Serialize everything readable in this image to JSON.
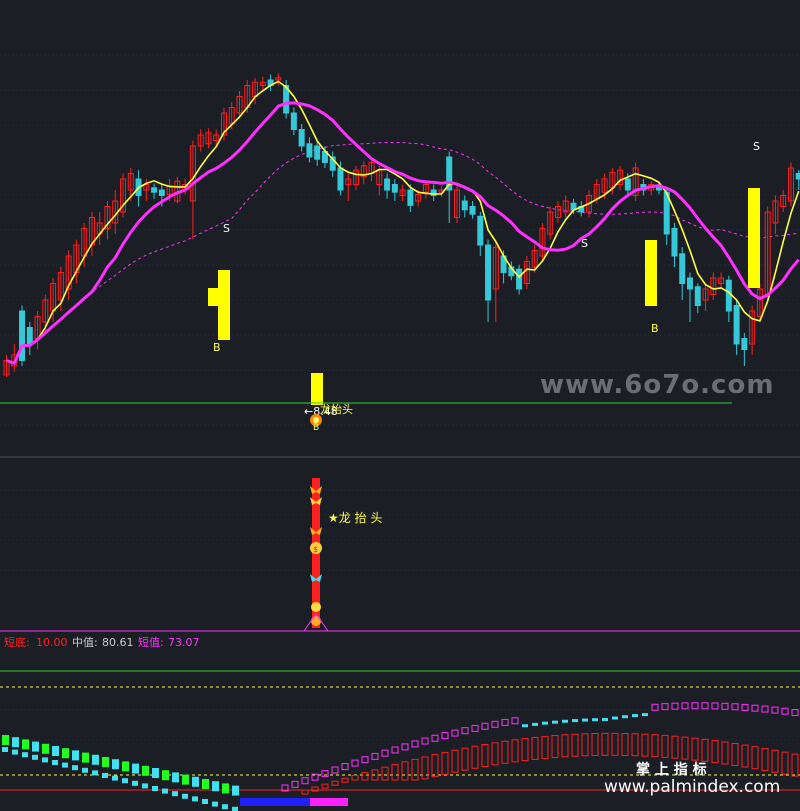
{
  "colors": {
    "background": "#1b1e25",
    "grid": "#3a3f4a",
    "up": "#ff2020",
    "down": "#35c8d8",
    "ma_short": "#ffff40",
    "ma_long": "#ff30ff",
    "ma_dotted": "#ff30ff",
    "signal_bar": "#ffff00",
    "support_line": "#30d030",
    "panel_red": "#ff2020",
    "panel_mid": "#cccccc",
    "panel_magenta": "#ff30ff",
    "cyan": "#40e0f0",
    "green": "#20ff20"
  },
  "main_panel": {
    "signals": [
      {
        "label": "S"
      },
      {
        "label": "B"
      },
      {
        "label": "S"
      },
      {
        "label": "B"
      },
      {
        "label": "S"
      }
    ],
    "low_price_label": "←8.48",
    "dragon_label": "龙抬头",
    "bottom_marker": "B"
  },
  "middle_panel": {
    "annotation": "★龙 抬 头"
  },
  "lower_panel": {
    "legend": [
      {
        "name": "短底:",
        "value": "10.00",
        "color": "#ff2020"
      },
      {
        "name": "中值:",
        "value": "80.61",
        "color": "#cccccc"
      },
      {
        "name": "短值:",
        "value": "73.07",
        "color": "#ff30ff"
      }
    ]
  },
  "watermarks": {
    "top": "www.6o7o.com",
    "cn": "掌  上  指  标",
    "bottom": "www.palmindex.com"
  },
  "chart_data": {
    "type": "candlestick",
    "title": "",
    "low_marker_value": 8.48,
    "candles_note": "qualitative trace",
    "candles": [
      [
        0,
        132,
        145,
        130,
        150,
        0
      ],
      [
        1,
        150,
        140,
        135,
        160,
        0
      ],
      [
        2,
        145,
        190,
        140,
        195,
        1
      ],
      [
        3,
        175,
        160,
        150,
        180,
        1
      ],
      [
        4,
        165,
        185,
        155,
        190,
        0
      ],
      [
        5,
        180,
        200,
        170,
        205,
        0
      ],
      [
        6,
        190,
        215,
        180,
        220,
        0
      ],
      [
        7,
        200,
        225,
        190,
        230,
        0
      ],
      [
        8,
        210,
        240,
        200,
        245,
        0
      ],
      [
        9,
        225,
        250,
        215,
        255,
        0
      ],
      [
        10,
        240,
        265,
        230,
        270,
        0
      ],
      [
        11,
        250,
        275,
        240,
        280,
        0
      ],
      [
        12,
        260,
        270,
        250,
        280,
        0
      ],
      [
        13,
        265,
        285,
        255,
        290,
        0
      ],
      [
        14,
        270,
        290,
        260,
        300,
        0
      ],
      [
        15,
        280,
        310,
        275,
        315,
        0
      ],
      [
        16,
        300,
        315,
        290,
        320,
        0
      ],
      [
        17,
        295,
        310,
        285,
        318,
        1
      ],
      [
        18,
        300,
        305,
        290,
        310,
        0
      ],
      [
        19,
        298,
        302,
        292,
        306,
        1
      ],
      [
        20,
        300,
        295,
        285,
        305,
        1
      ],
      [
        21,
        296,
        304,
        290,
        310,
        0
      ],
      [
        22,
        290,
        308,
        288,
        312,
        0
      ],
      [
        23,
        300,
        305,
        296,
        310,
        0
      ],
      [
        24,
        290,
        340,
        255,
        345,
        0
      ],
      [
        25,
        340,
        350,
        335,
        355,
        0
      ],
      [
        26,
        342,
        352,
        338,
        356,
        0
      ],
      [
        27,
        345,
        350,
        340,
        355,
        0
      ],
      [
        28,
        350,
        370,
        345,
        375,
        0
      ],
      [
        29,
        360,
        375,
        355,
        380,
        0
      ],
      [
        30,
        370,
        385,
        365,
        390,
        0
      ],
      [
        31,
        375,
        395,
        370,
        400,
        0
      ],
      [
        32,
        385,
        398,
        378,
        402,
        0
      ],
      [
        33,
        395,
        398,
        390,
        403,
        0
      ],
      [
        34,
        395,
        400,
        390,
        405,
        1
      ],
      [
        35,
        400,
        402,
        395,
        406,
        0
      ],
      [
        36,
        395,
        370,
        365,
        400,
        1
      ],
      [
        37,
        370,
        355,
        350,
        375,
        1
      ],
      [
        38,
        355,
        340,
        335,
        360,
        1
      ],
      [
        39,
        342,
        330,
        325,
        348,
        1
      ],
      [
        40,
        340,
        328,
        322,
        345,
        1
      ],
      [
        41,
        335,
        325,
        320,
        340,
        1
      ],
      [
        42,
        330,
        318,
        312,
        335,
        1
      ],
      [
        43,
        320,
        300,
        295,
        326,
        1
      ],
      [
        44,
        305,
        310,
        290,
        315,
        0
      ],
      [
        45,
        305,
        318,
        300,
        322,
        0
      ],
      [
        46,
        312,
        322,
        305,
        326,
        0
      ],
      [
        47,
        315,
        325,
        308,
        330,
        0
      ],
      [
        48,
        305,
        318,
        295,
        322,
        0
      ],
      [
        49,
        300,
        310,
        292,
        315,
        1
      ],
      [
        50,
        305,
        298,
        290,
        310,
        1
      ],
      [
        51,
        295,
        300,
        290,
        305,
        0
      ],
      [
        52,
        300,
        286,
        280,
        305,
        1
      ],
      [
        53,
        290,
        296,
        285,
        300,
        0
      ],
      [
        54,
        298,
        305,
        292,
        308,
        0
      ],
      [
        55,
        300,
        295,
        290,
        305,
        1
      ],
      [
        56,
        298,
        300,
        294,
        304,
        0
      ],
      [
        57,
        300,
        330,
        270,
        335,
        1
      ],
      [
        58,
        275,
        300,
        270,
        305,
        0
      ],
      [
        59,
        282,
        290,
        275,
        295,
        1
      ],
      [
        60,
        285,
        278,
        274,
        290,
        1
      ],
      [
        61,
        276,
        250,
        240,
        280,
        1
      ],
      [
        62,
        250,
        200,
        180,
        255,
        1
      ],
      [
        63,
        210,
        248,
        180,
        255,
        0
      ],
      [
        64,
        240,
        225,
        215,
        245,
        1
      ],
      [
        65,
        230,
        222,
        218,
        235,
        1
      ],
      [
        66,
        228,
        210,
        205,
        232,
        1
      ],
      [
        67,
        215,
        235,
        210,
        240,
        0
      ],
      [
        68,
        230,
        245,
        225,
        250,
        0
      ],
      [
        69,
        240,
        265,
        235,
        270,
        0
      ],
      [
        70,
        260,
        280,
        255,
        285,
        0
      ],
      [
        71,
        275,
        285,
        270,
        290,
        0
      ],
      [
        72,
        280,
        290,
        275,
        295,
        0
      ],
      [
        73,
        282,
        288,
        278,
        292,
        1
      ],
      [
        74,
        285,
        280,
        276,
        290,
        1
      ],
      [
        75,
        280,
        295,
        275,
        300,
        0
      ],
      [
        76,
        292,
        305,
        288,
        310,
        0
      ],
      [
        77,
        298,
        310,
        292,
        315,
        0
      ],
      [
        78,
        302,
        316,
        296,
        320,
        0
      ],
      [
        79,
        305,
        318,
        300,
        322,
        0
      ],
      [
        80,
        300,
        310,
        295,
        315,
        1
      ],
      [
        81,
        295,
        320,
        290,
        325,
        0
      ],
      [
        82,
        305,
        300,
        295,
        310,
        1
      ],
      [
        83,
        300,
        305,
        295,
        308,
        0
      ],
      [
        84,
        302,
        300,
        296,
        306,
        1
      ],
      [
        85,
        298,
        260,
        250,
        302,
        1
      ],
      [
        86,
        265,
        240,
        230,
        270,
        1
      ],
      [
        87,
        242,
        215,
        200,
        248,
        1
      ],
      [
        88,
        220,
        210,
        180,
        225,
        1
      ],
      [
        89,
        212,
        195,
        188,
        215,
        1
      ],
      [
        90,
        200,
        210,
        190,
        215,
        0
      ],
      [
        91,
        205,
        220,
        200,
        225,
        0
      ],
      [
        92,
        215,
        220,
        210,
        225,
        0
      ],
      [
        93,
        218,
        190,
        180,
        222,
        1
      ],
      [
        94,
        195,
        160,
        150,
        200,
        1
      ],
      [
        95,
        165,
        155,
        140,
        170,
        1
      ],
      [
        96,
        160,
        190,
        150,
        195,
        0
      ],
      [
        97,
        185,
        210,
        180,
        215,
        0
      ],
      [
        98,
        205,
        280,
        200,
        285,
        0
      ],
      [
        99,
        270,
        290,
        260,
        295,
        0
      ],
      [
        100,
        285,
        295,
        280,
        300,
        0
      ],
      [
        101,
        290,
        320,
        285,
        325,
        0
      ],
      [
        102,
        315,
        310,
        300,
        318,
        1
      ]
    ],
    "series": [
      {
        "name": "",
        "color": "#ffff40"
      },
      {
        "name": "",
        "color": "#ff30ff"
      }
    ]
  }
}
